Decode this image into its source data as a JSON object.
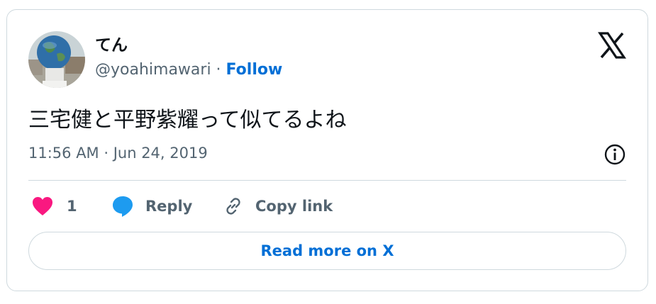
{
  "user": {
    "display_name": "てん",
    "handle": "@yoahimawari",
    "separator": " · ",
    "follow_label": "Follow"
  },
  "tweet": {
    "text": "三宅健と平野紫耀って似てるよね",
    "timestamp": "11:56 AM · Jun 24, 2019"
  },
  "actions": {
    "like_count": "1",
    "reply_label": "Reply",
    "copy_label": "Copy link"
  },
  "read_more_label": "Read more on X",
  "icons": {
    "logo": "x-logo-icon",
    "info": "info-icon",
    "like": "heart-icon",
    "reply": "speech-bubble-icon",
    "copy": "link-icon"
  },
  "colors": {
    "text": "#0f1419",
    "secondary": "#536471",
    "link": "#006fd6",
    "heart": "#f91880",
    "reply": "#1d9bf0",
    "border": "#cfd9de"
  }
}
